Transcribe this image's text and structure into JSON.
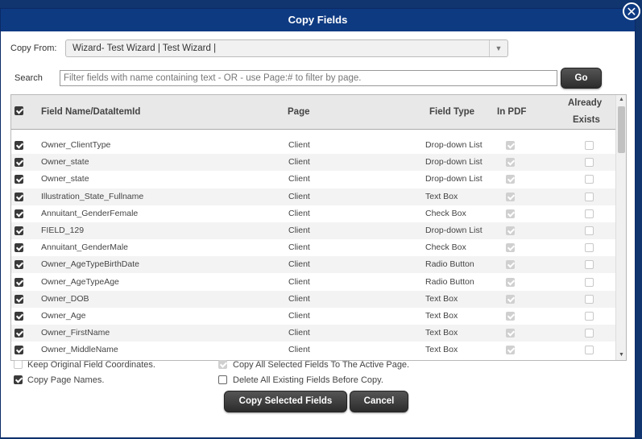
{
  "dialog": {
    "title": "Copy Fields"
  },
  "copy_from": {
    "label": "Copy From:",
    "value": "Wizard- Test Wizard | Test Wizard |"
  },
  "search": {
    "label": "Search",
    "placeholder": "Filter fields with name containing text - OR - use Page:# to filter by page.",
    "go_label": "Go"
  },
  "table": {
    "headers": {
      "name": "Field Name/DataItemId",
      "page": "Page",
      "type": "Field Type",
      "in_pdf": "In PDF",
      "exists_line1": "Already",
      "exists_line2": "Exists"
    },
    "rows": [
      {
        "name": "Owner_ClientType",
        "page": "Client",
        "type": "Drop-down List"
      },
      {
        "name": "Owner_state",
        "page": "Client",
        "type": "Drop-down List"
      },
      {
        "name": "Owner_state",
        "page": "Client",
        "type": "Drop-down List"
      },
      {
        "name": "Illustration_State_Fullname",
        "page": "Client",
        "type": "Text Box"
      },
      {
        "name": "Annuitant_GenderFemale",
        "page": "Client",
        "type": "Check Box"
      },
      {
        "name": "FIELD_129",
        "page": "Client",
        "type": "Drop-down List"
      },
      {
        "name": "Annuitant_GenderMale",
        "page": "Client",
        "type": "Check Box"
      },
      {
        "name": "Owner_AgeTypeBirthDate",
        "page": "Client",
        "type": "Radio Button"
      },
      {
        "name": "Owner_AgeTypeAge",
        "page": "Client",
        "type": "Radio Button"
      },
      {
        "name": "Owner_DOB",
        "page": "Client",
        "type": "Text Box"
      },
      {
        "name": "Owner_Age",
        "page": "Client",
        "type": "Text Box"
      },
      {
        "name": "Owner_FirstName",
        "page": "Client",
        "type": "Text Box"
      },
      {
        "name": "Owner_MiddleName",
        "page": "Client",
        "type": "Text Box"
      }
    ]
  },
  "options": {
    "keep_coords": "Keep Original Field Coordinates.",
    "copy_page_names": "Copy Page Names.",
    "copy_to_active": "Copy All Selected Fields To The Active Page.",
    "delete_existing": "Delete All Existing Fields Before Copy."
  },
  "buttons": {
    "copy": "Copy Selected Fields",
    "cancel": "Cancel"
  }
}
